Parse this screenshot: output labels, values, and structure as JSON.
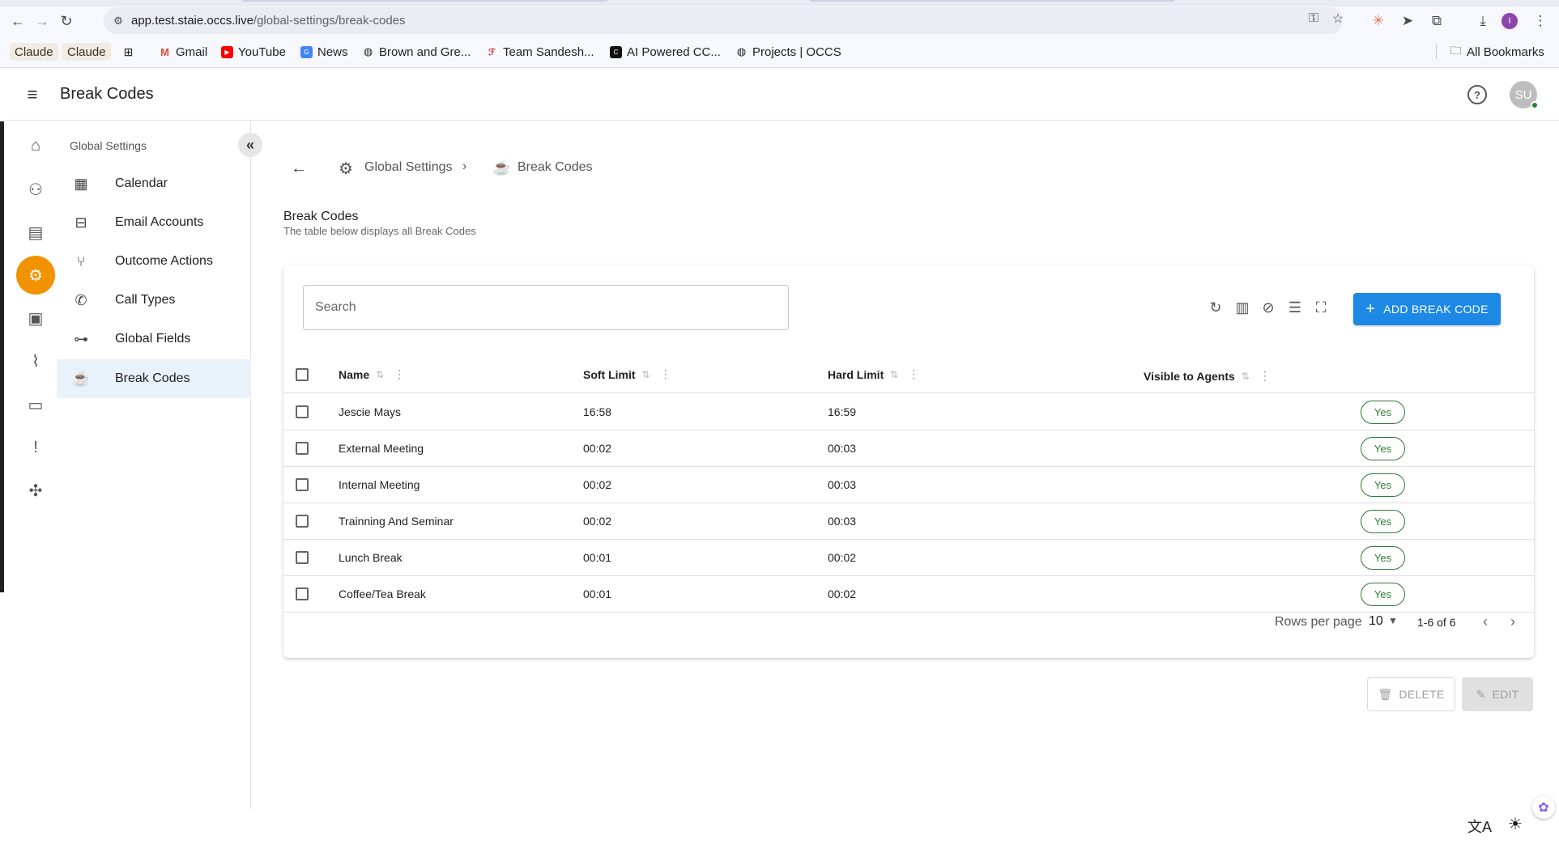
{
  "browser": {
    "url_host": "app.test.staie.occs.live",
    "url_path": "/global-settings/break-codes",
    "bookmarks": [
      {
        "label": "Claude",
        "icon": "claude-icon"
      },
      {
        "label": "Claude",
        "icon": "claude-icon"
      },
      {
        "label": "Gmail",
        "icon": "gmail-icon"
      },
      {
        "label": "YouTube",
        "icon": "youtube-icon"
      },
      {
        "label": "News",
        "icon": "news-icon"
      },
      {
        "label": "Brown and Gre...",
        "icon": "globe-icon"
      },
      {
        "label": "Team Sandesh...",
        "icon": "team-icon"
      },
      {
        "label": "AI Powered CC...",
        "icon": "ai-icon"
      },
      {
        "label": "Projects | OCCS",
        "icon": "globe-icon"
      }
    ],
    "all_bookmarks": "All Bookmarks",
    "profile_initial": "I"
  },
  "header": {
    "title": "Break Codes",
    "avatar_initials": "SU"
  },
  "subnav": {
    "title": "Global Settings",
    "items": [
      {
        "label": "Calendar",
        "icon": "calendar-icon"
      },
      {
        "label": "Email Accounts",
        "icon": "email-account-icon"
      },
      {
        "label": "Outcome Actions",
        "icon": "fork-icon"
      },
      {
        "label": "Call Types",
        "icon": "phone-icon"
      },
      {
        "label": "Global Fields",
        "icon": "fields-icon"
      },
      {
        "label": "Break Codes",
        "icon": "coffee-icon"
      }
    ]
  },
  "breadcrumb": {
    "parent": "Global Settings",
    "current": "Break Codes"
  },
  "section": {
    "title": "Break Codes",
    "subtitle": "The table below displays all Break Codes"
  },
  "table": {
    "search_placeholder": "Search",
    "add_label": "ADD BREAK CODE",
    "columns": [
      "Name",
      "Soft Limit",
      "Hard Limit",
      "Visible to Agents"
    ],
    "rows": [
      {
        "name": "Jescie Mays",
        "soft": "16:58",
        "hard": "16:59",
        "visible": "Yes"
      },
      {
        "name": "External Meeting",
        "soft": "00:02",
        "hard": "00:03",
        "visible": "Yes"
      },
      {
        "name": "Internal Meeting",
        "soft": "00:02",
        "hard": "00:03",
        "visible": "Yes"
      },
      {
        "name": "Trainning And Seminar",
        "soft": "00:02",
        "hard": "00:03",
        "visible": "Yes"
      },
      {
        "name": "Lunch Break",
        "soft": "00:01",
        "hard": "00:02",
        "visible": "Yes"
      },
      {
        "name": "Coffee/Tea Break",
        "soft": "00:01",
        "hard": "00:02",
        "visible": "Yes"
      }
    ],
    "rows_per_page_label": "Rows per page",
    "rows_per_page": "10",
    "range": "1-6 of 6"
  },
  "actions": {
    "delete": "DELETE",
    "edit": "EDIT"
  },
  "colors": {
    "accent": "#f39200",
    "primary": "#1e88e5",
    "chip_green": "#2e7d32"
  }
}
